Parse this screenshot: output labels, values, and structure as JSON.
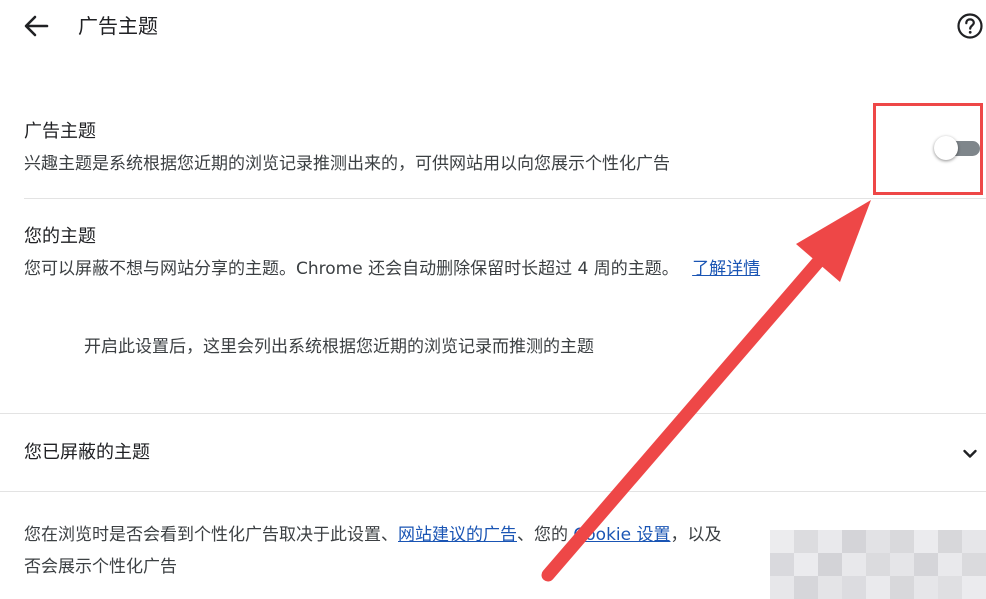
{
  "header": {
    "title": "广告主题",
    "back_icon": "arrow-left-icon",
    "help_icon": "help-circle-icon"
  },
  "ad_topics": {
    "title": "广告主题",
    "description": "兴趣主题是系统根据您近期的浏览记录推测出来的，可供网站用以向您展示个性化广告",
    "toggle_on": false
  },
  "your_topics": {
    "title": "您的主题",
    "description": "您可以屏蔽不想与网站分享的主题。Chrome 还会自动删除保留时长超过 4 周的主题。",
    "learn_more": "了解详情",
    "empty_state": "开启此设置后，这里会列出系统根据您近期的浏览记录而推测的主题"
  },
  "blocked_topics": {
    "title": "您已屏蔽的主题",
    "expand_icon": "chevron-down-icon"
  },
  "footer": {
    "text_1": "您在浏览时是否会看到个性化广告取决于此设置、",
    "link_1": "网站建议的广告",
    "text_2": "、您的 ",
    "link_2": "Cookie 设置",
    "text_3": "，以及",
    "line_2": "否会展示个性化广告"
  },
  "colors": {
    "annotation_red": "#ee4747",
    "link_blue": "#1a55b4",
    "toggle_off_track": "#7f868b"
  }
}
